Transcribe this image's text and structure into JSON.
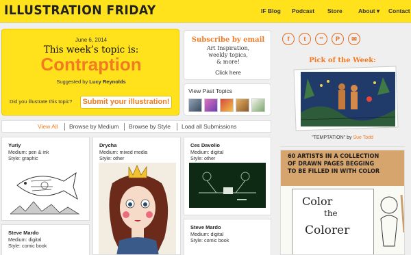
{
  "header": {
    "logo": "ILLUSTRATION FRIDAY",
    "nav": [
      {
        "label": "IF Blog"
      },
      {
        "label": "Podcast"
      },
      {
        "label": "Store"
      },
      {
        "label": "About ▾"
      },
      {
        "label": "Contact"
      }
    ]
  },
  "topic": {
    "date": "June 6, 2014",
    "heading": "This week’s topic is:",
    "word": "Contraption",
    "suggested_prefix": "Suggested by ",
    "suggested_by": "Lucy Reynolds",
    "question": "Did you illustrate this topic?",
    "submit_label": "Submit your illustration!"
  },
  "subscribe": {
    "title": "Subscribe by email",
    "line1": "Art Inspiration,",
    "line2": "weekly topics,",
    "line3": "& more!",
    "click": "Click here"
  },
  "past_topics": {
    "title": "View Past Topics"
  },
  "social": [
    {
      "icon": "facebook-icon",
      "glyph": "f"
    },
    {
      "icon": "twitter-icon",
      "glyph": "t"
    },
    {
      "icon": "flickr-icon",
      "glyph": "••"
    },
    {
      "icon": "pinterest-icon",
      "glyph": "P"
    },
    {
      "icon": "email-icon",
      "glyph": "✉"
    }
  ],
  "pick": {
    "title": "Pick of the Week:",
    "caption": "\"TEMPTATION\" by ",
    "author": "Sue Todd"
  },
  "ad": {
    "top_line1": "60 ARTISTS IN A COLLECTION",
    "top_line2": "OF DRAWN PAGES BEGGING",
    "top_line3": "TO BE FILLED IN WITH COLOR",
    "cover_line1": "Color",
    "cover_line2": "the",
    "cover_line3": "Colorer"
  },
  "browse": {
    "tabs": [
      {
        "label": "View All"
      },
      {
        "label": "Browse by Medium"
      },
      {
        "label": "Browse by Style"
      },
      {
        "label": "Load all Submissions"
      }
    ]
  },
  "submissions": [
    {
      "name": "Yuriy",
      "medium": "Medium: pen & ink",
      "style": "Style: graphic"
    },
    {
      "name": "Drycha",
      "medium": "Medium: mixed media",
      "style": "Style: other"
    },
    {
      "name": "Ces Davolio",
      "medium": "Medium: digital",
      "style": "Style: other"
    },
    {
      "name": "Steve Mardo",
      "medium": "Medium: digital",
      "style": "Style: comic book"
    },
    {
      "name": "Steve Mardo",
      "medium": "Medium: digital",
      "style": "Style: comic book"
    }
  ],
  "colors": {
    "brand_yellow": "#ffe21b",
    "accent_orange": "#f27b22"
  }
}
